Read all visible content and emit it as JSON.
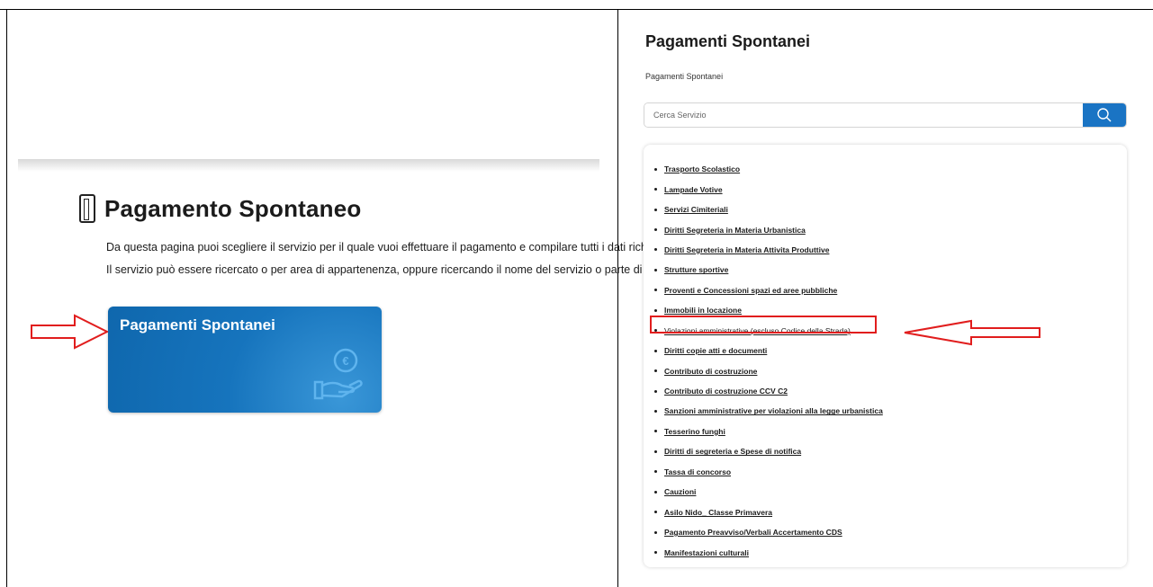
{
  "left": {
    "title": "Pagamento Spontaneo",
    "description_line1": "Da questa pagina puoi scegliere il servizio per il quale vuoi effettuare il pagamento e compilare tutti i dati richiesti.",
    "description_line2": "Il servizio può essere ricercato o per area di appartenenza, oppure ricercando il nome del servizio o parte di esso.",
    "tile_label": "Pagamenti Spontanei",
    "tile_icon": "hand-euro-icon",
    "tile_color": "#1674bd"
  },
  "right": {
    "title": "Pagamenti Spontanei",
    "subtitle": "Pagamenti Spontanei",
    "search": {
      "placeholder": "Cerca Servizio",
      "value": "",
      "button_icon": "search-icon"
    },
    "services": [
      "Trasporto Scolastico",
      "Lampade Votive",
      "Servizi Cimiteriali",
      "Diritti Segreteria in Materia Urbanistica",
      "Diritti Segreteria in Materia Attivita Produttive",
      "Strutture sportive",
      "Proventi e Concessioni spazi ed aree pubbliche",
      "Immobili in locazione",
      "Violazioni amministrative (escluso Codice della Strada)",
      "Diritti copie atti e documenti",
      "Contributo di costruzione",
      "Contributo di costruzione CCV C2",
      "Sanzioni amministrative per violazioni alla legge urbanistica",
      "Tesserino funghi",
      "Diritti di segreteria e Spese di notifica",
      "Tassa di concorso",
      "Cauzioni",
      "Asilo Nido_ Classe Primavera",
      "Pagamento Preavviso/Verbali Accertamento CDS",
      "Manifestazioni culturali"
    ],
    "highlighted_service": "Violazioni amministrative (escluso Codice della Strada)"
  },
  "colors": {
    "accent": "#1a74c4",
    "annotation": "#e11d1d"
  }
}
